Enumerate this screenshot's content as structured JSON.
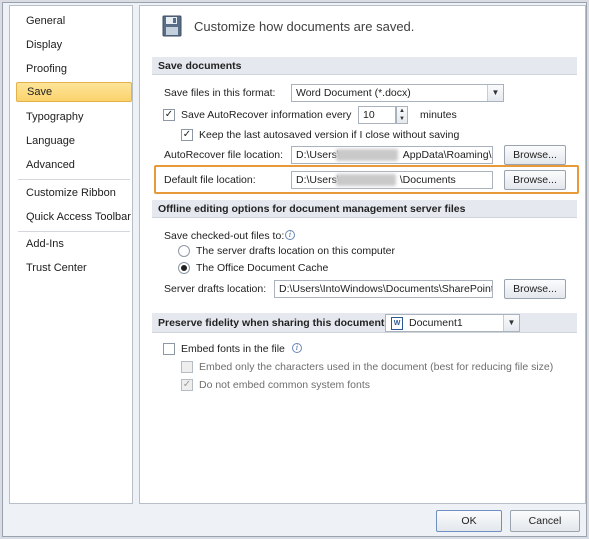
{
  "nav": {
    "items": [
      {
        "label": "General"
      },
      {
        "label": "Display"
      },
      {
        "label": "Proofing"
      },
      {
        "label": "Save"
      },
      {
        "label": "Typography"
      },
      {
        "label": "Language"
      },
      {
        "label": "Advanced"
      },
      {
        "label": "Customize Ribbon"
      },
      {
        "label": "Quick Access Toolbar"
      },
      {
        "label": "Add-Ins"
      },
      {
        "label": "Trust Center"
      }
    ],
    "selected": "Save"
  },
  "header": {
    "title": "Customize how documents are saved."
  },
  "save_documents": {
    "section_title": "Save documents",
    "format_label": "Save files in this format:",
    "format_value": "Word Document (*.docx)",
    "autorecover_label": "Save AutoRecover information every",
    "autorecover_checked": true,
    "autorecover_minutes": "10",
    "minutes_label": "minutes",
    "keep_last_label": "Keep the last autosaved version if I close without saving",
    "keep_last_checked": true,
    "autorecover_location_label": "AutoRecover file location:",
    "autorecover_location_prefix": "D:\\Users\\",
    "autorecover_location_suffix": "AppData\\Roaming\\",
    "default_location_label": "Default file location:",
    "default_location_prefix": "D:\\Users\\",
    "default_location_suffix": "\\Documents",
    "browse_label": "Browse..."
  },
  "offline": {
    "section_title": "Offline editing options for document management server files",
    "save_checked_out_label": "Save checked-out files to:",
    "option_server": "The server drafts location on this computer",
    "option_cache": "The Office Document Cache",
    "selected_option": "cache",
    "server_drafts_label": "Server drafts location:",
    "server_drafts_value": "D:\\Users\\IntoWindows\\Documents\\SharePoint Drafts\\",
    "browse_label": "Browse..."
  },
  "fidelity": {
    "section_title": "Preserve fidelity when sharing this document:",
    "document_value": "Document1",
    "embed_fonts_label": "Embed fonts in the file",
    "embed_fonts_checked": false,
    "embed_chars_label": "Embed only the characters used in the document (best for reducing file size)",
    "embed_chars_checked": false,
    "no_common_label": "Do not embed common system fonts",
    "no_common_checked": true
  },
  "footer": {
    "ok_label": "OK",
    "cancel_label": "Cancel"
  },
  "colors": {
    "highlight": "#e89a3a",
    "selected_nav": "#fbd36b"
  }
}
